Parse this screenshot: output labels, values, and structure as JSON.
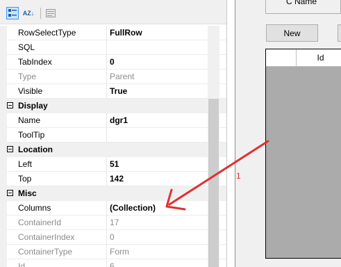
{
  "toolbar": {
    "buttons": [
      {
        "icon": "categorized-icon",
        "active": true
      },
      {
        "icon": "alphabetical-icon",
        "label": "AZ",
        "active": false
      },
      {
        "icon": "property-pages-icon",
        "active": false
      }
    ]
  },
  "properties": [
    {
      "name": "RowSelectType",
      "value": "FullRow",
      "bold": true
    },
    {
      "name": "SQL",
      "value": ""
    },
    {
      "name": "TabIndex",
      "value": "0",
      "bold": true
    },
    {
      "name": "Type",
      "value": "Parent",
      "greyed": true
    },
    {
      "name": "Visible",
      "value": "True",
      "bold": true
    },
    {
      "category": "Display"
    },
    {
      "name": "Name",
      "value": "dgr1",
      "bold": true
    },
    {
      "name": "ToolTip",
      "value": ""
    },
    {
      "category": "Location"
    },
    {
      "name": "Left",
      "value": "51",
      "bold": true
    },
    {
      "name": "Top",
      "value": "142",
      "bold": true
    },
    {
      "category": "Misc"
    },
    {
      "name": "Columns",
      "value": "(Collection)",
      "bold": true
    },
    {
      "name": "ContainerId",
      "value": "17",
      "greyed": true
    },
    {
      "name": "ContainerIndex",
      "value": "0",
      "greyed": true
    },
    {
      "name": "ContainerType",
      "value": "Form",
      "greyed": true
    },
    {
      "name": "Id",
      "value": "6",
      "greyed": true
    }
  ],
  "designer": {
    "cname_label": "C Name",
    "new_button_label": "New",
    "grid_column_id": "Id"
  },
  "annotation": {
    "number": "1",
    "color": "#e03030"
  }
}
